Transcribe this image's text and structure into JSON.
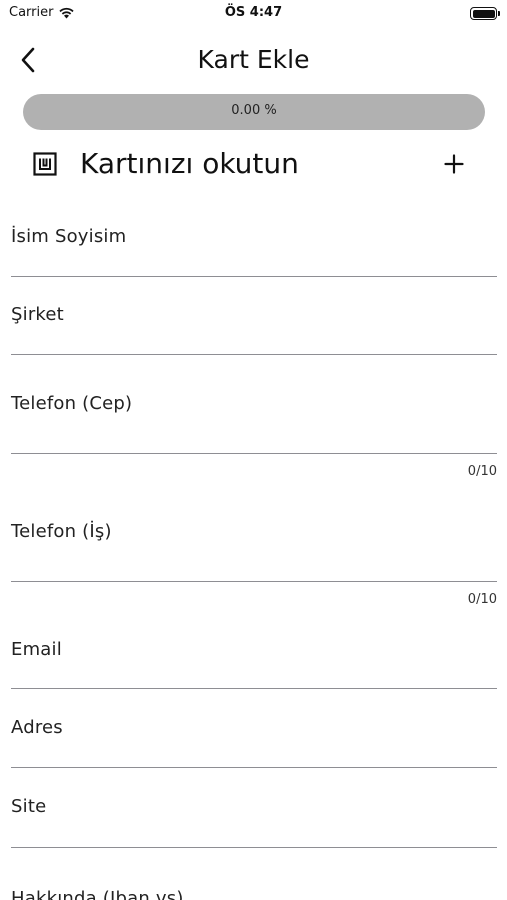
{
  "status_bar": {
    "carrier": "Carrier",
    "time": "ÖS 4:47"
  },
  "nav": {
    "title": "Kart Ekle"
  },
  "progress": {
    "text": "0.00 %",
    "value_percent": 0
  },
  "scan": {
    "label": "Kartınızı okutun",
    "add_symbol": "+"
  },
  "form": {
    "name": {
      "label": "İsim Soyisim",
      "value": ""
    },
    "company": {
      "label": "Şirket",
      "value": ""
    },
    "phone_mobile": {
      "label": "Telefon (Cep)",
      "value": "",
      "counter": "0/10"
    },
    "phone_work": {
      "label": "Telefon (İş)",
      "value": "",
      "counter": "0/10"
    },
    "email": {
      "label": "Email",
      "value": ""
    },
    "address": {
      "label": "Adres",
      "value": ""
    },
    "site": {
      "label": "Site",
      "value": ""
    },
    "about": {
      "label": "Hakkında (Iban vs)",
      "value": ""
    }
  },
  "icons": {
    "back": "chevron-left-icon",
    "scan": "card-scan-icon",
    "add": "plus-icon",
    "wifi": "wifi-icon",
    "battery": "battery-icon"
  },
  "colors": {
    "progress_track": "#b1b1b1",
    "underline": "#8e8e93",
    "text": "#1c1c1e"
  }
}
